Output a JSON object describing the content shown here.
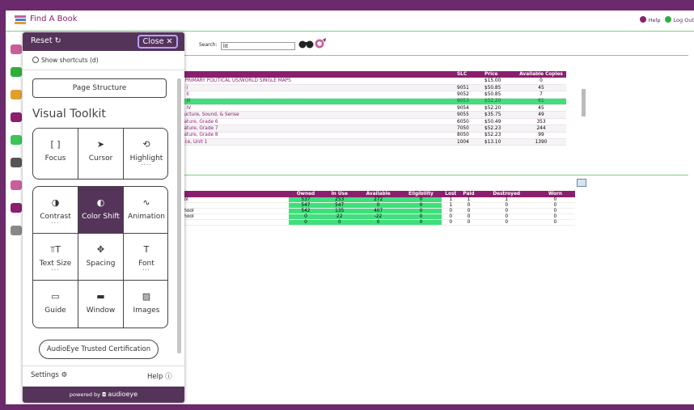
{
  "app": {
    "title": "Find A Book",
    "help": "Help",
    "logout": "Log Out"
  },
  "search": {
    "label": "Search:",
    "value": "lit"
  },
  "results": {
    "columns": [
      "",
      "SLC",
      "Price",
      "Available Copies"
    ],
    "rows": [
      [
        "l PRIMARY POLITICAL US/WORLD SINGLE MAPS",
        "",
        "$15.00",
        "0"
      ],
      [
        "e I",
        "9051",
        "$50.85",
        "45"
      ],
      [
        "e II",
        "9052",
        "$50.85",
        "7"
      ],
      [
        "e III",
        "9053",
        "$52.20",
        "61"
      ],
      [
        "e IV",
        "9054",
        "$52.20",
        "45"
      ],
      [
        "ructure, Sound, & Sense",
        "9055",
        "$35.75",
        "49"
      ],
      [
        "rature, Grade 6",
        "6050",
        "$50.49",
        "353"
      ],
      [
        "rature, Grade 7",
        "7050",
        "$52.23",
        "244"
      ],
      [
        "rature, Grade 8",
        "8050",
        "$52.23",
        "99"
      ],
      [
        "ace, Unit 1",
        "1004",
        "$13.10",
        "1390"
      ]
    ],
    "selected_index": 3
  },
  "copies": {
    "columns": [
      "",
      "Owned",
      "In Use",
      "Available",
      "Eligibility",
      "Lost",
      "Paid",
      "Destroyed",
      "Worn"
    ],
    "rows": [
      [
        "ool",
        "537",
        "253",
        "272",
        "0",
        "1",
        "1",
        "1",
        "0"
      ],
      [
        "",
        "547",
        "547",
        "0",
        "0",
        "1",
        "0",
        "0",
        "0"
      ],
      [
        "chool",
        "542",
        "135",
        "407",
        "0",
        "0",
        "0",
        "0",
        "0"
      ],
      [
        "chool",
        "0",
        "22",
        "-22",
        "0",
        "0",
        "0",
        "0",
        "0"
      ],
      [
        "",
        "0",
        "0",
        "0",
        "0",
        "0",
        "0",
        "0",
        "0"
      ]
    ]
  },
  "toolkit": {
    "reset": "Reset",
    "close": "Close",
    "shortcuts": "Show shortcuts (d)",
    "page_structure": "Page Structure",
    "title": "Visual Toolkit",
    "group1": [
      {
        "label": "Focus",
        "icon": "[ ]"
      },
      {
        "label": "Cursor",
        "icon": "➤"
      },
      {
        "label": "Highlight",
        "icon": "⟲",
        "dots": "····"
      }
    ],
    "group2": [
      {
        "label": "Contrast",
        "icon": "◑",
        "dots": "···"
      },
      {
        "label": "Color Shift",
        "icon": "◐",
        "active": true
      },
      {
        "label": "Animation",
        "icon": "∿"
      },
      {
        "label": "Text Size",
        "icon": "⫪T",
        "dots": "···"
      },
      {
        "label": "Spacing",
        "icon": "✥"
      },
      {
        "label": "Font",
        "icon": "T",
        "dots": "···"
      },
      {
        "label": "Guide",
        "icon": "▭"
      },
      {
        "label": "Window",
        "icon": "▬"
      },
      {
        "label": "Images",
        "icon": "▨"
      }
    ],
    "certification": "AudioEye Trusted Certification",
    "settings": "Settings",
    "help": "Help",
    "powered_by": "powered by",
    "brand": "audioeye"
  },
  "colors": {
    "frame": "#6b2a6b",
    "header_row": "#8a1f6f",
    "highlight": "#3ee07a",
    "panel": "#55345a"
  }
}
